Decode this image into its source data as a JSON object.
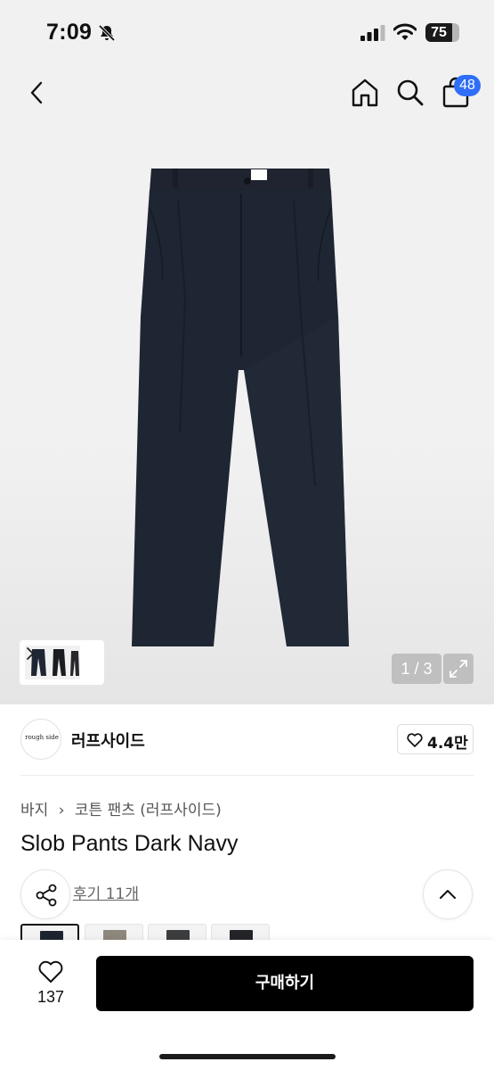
{
  "status_bar": {
    "time": "7:09",
    "battery_level": "75",
    "icons": [
      "bell-off-icon",
      "signal-icon",
      "wifi-icon",
      "battery-icon"
    ]
  },
  "header": {
    "icons": [
      "back-icon",
      "home-icon",
      "search-icon",
      "shopping-bag-icon"
    ],
    "bag_count": "48"
  },
  "gallery": {
    "page_indicator": "1 / 3",
    "image_count": 3,
    "current_image": 1,
    "icons": [
      "chevron-right-icon",
      "expand-icon"
    ]
  },
  "brand": {
    "logo_text": "rough side",
    "name": "러프사이드",
    "like_count": "4.4만"
  },
  "product": {
    "breadcrumb": [
      "바지",
      "코튼 팬츠 (러프사이드)"
    ],
    "breadcrumb_separator": "›",
    "title": "Slob Pants Dark Navy",
    "reviews": "후기 11개"
  },
  "options": {
    "swatch_colors": [
      "#1d2330",
      "#8d877c",
      "#3c3d3f",
      "#222428"
    ]
  },
  "bottom_bar": {
    "wish_count": "137",
    "buy_label": "구매하기"
  },
  "colors": {
    "accent_badge": "#2f6ef6",
    "buy_button": "#000000",
    "product_navy": "#1f2633"
  }
}
